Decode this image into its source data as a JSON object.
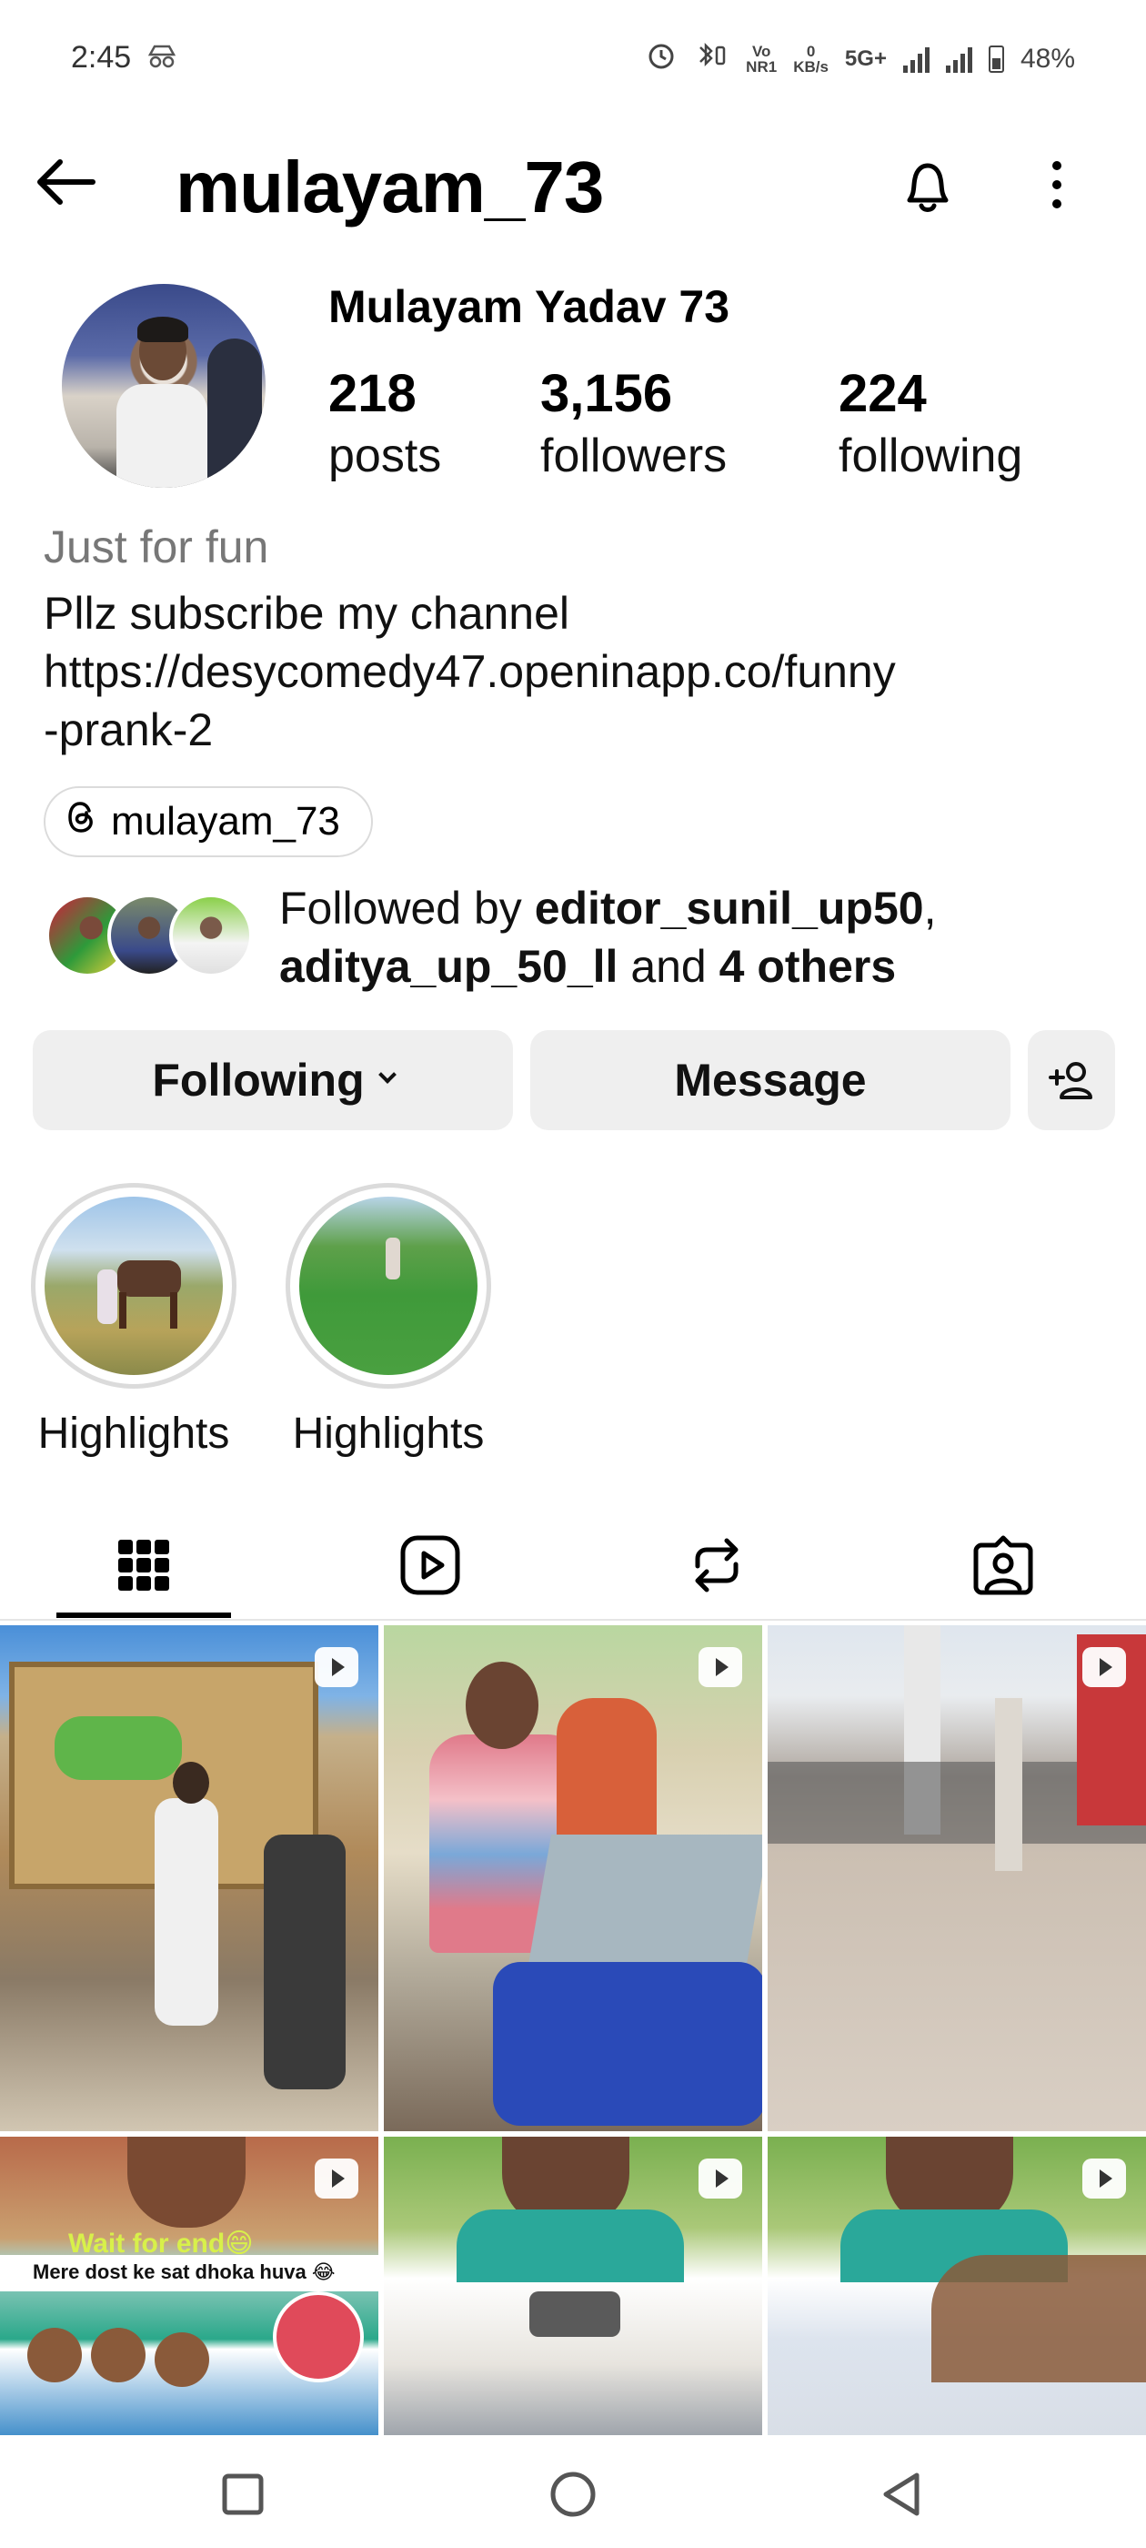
{
  "status_bar": {
    "time": "2:45",
    "network_vo": "Vo",
    "network_nr": "NR1",
    "speed_value": "0",
    "speed_unit": "KB/s",
    "network_type": "5G+",
    "battery": "48%"
  },
  "header": {
    "username": "mulayam_73"
  },
  "profile": {
    "display_name": "Mulayam Yadav 73",
    "posts_count": "218",
    "posts_label": "posts",
    "followers_count": "3,156",
    "followers_label": "followers",
    "following_count": "224",
    "following_label": "following"
  },
  "bio": {
    "category": "Just for fun",
    "line1": "Pllz subscribe my channel",
    "line2": "https://desycomedy47.openinapp.co/funny",
    "line3": "-prank-2",
    "threads_handle": "mulayam_73"
  },
  "followed_by": {
    "prefix": "Followed by ",
    "user1": "editor_sunil_up50",
    "separator": ",",
    "user2": "aditya_up_50_ll",
    "and": " and ",
    "others": "4 others"
  },
  "actions": {
    "following_label": "Following",
    "message_label": "Message"
  },
  "highlights": [
    {
      "label": "Highlights"
    },
    {
      "label": "Highlights"
    }
  ],
  "tabs": [
    "grid-icon",
    "reels-icon",
    "reposts-icon",
    "tagged-icon"
  ],
  "grid_overlays": {
    "wait_text": "Wait for end😄",
    "dost_text": "Mere dost ke sat dhoka huva 😂"
  },
  "colors": {
    "button_bg": "#efefef",
    "secondary_text": "#777777"
  }
}
